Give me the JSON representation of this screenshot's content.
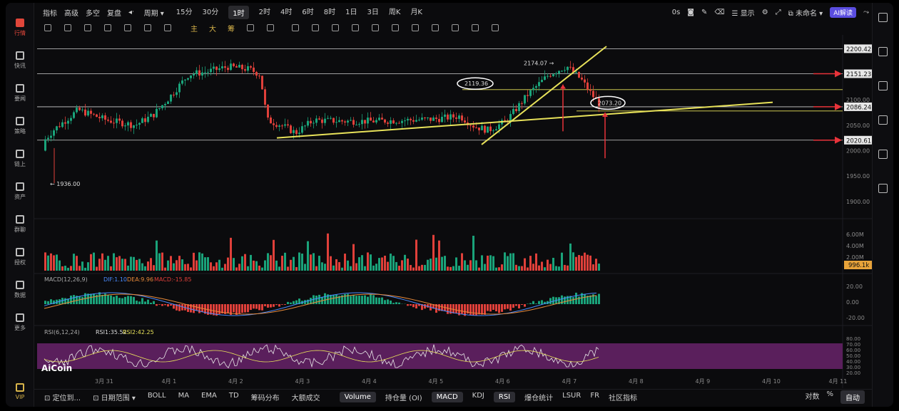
{
  "sidebar": {
    "items": [
      {
        "label": "行情",
        "icon": "chart-bar-icon",
        "active": true
      },
      {
        "label": "快讯",
        "icon": "news-icon"
      },
      {
        "label": "要闻",
        "icon": "article-icon"
      },
      {
        "label": "策略",
        "icon": "strategy-icon"
      },
      {
        "label": "链上",
        "icon": "chain-icon"
      },
      {
        "label": "资产",
        "icon": "wallet-icon"
      },
      {
        "label": "群聊",
        "icon": "chat-icon"
      },
      {
        "label": "授权",
        "icon": "key-icon"
      },
      {
        "label": "数据",
        "icon": "data-icon"
      },
      {
        "label": "更多",
        "icon": "grid-icon"
      },
      {
        "label": "VIP",
        "icon": "crown-icon"
      }
    ]
  },
  "toolbar": {
    "indicators": "指标",
    "advanced": "高级",
    "multi": "多空",
    "replay": "复盘",
    "period": "周期",
    "intervals": [
      "15分",
      "30分",
      "1时",
      "2时",
      "4时",
      "6时",
      "8时",
      "1日",
      "3日",
      "周K",
      "月K"
    ],
    "selected_interval": "1时",
    "zero_s": "0s",
    "display": "显示",
    "unnamed": "未命名",
    "ai": "AI解读"
  },
  "drawing_bar": {
    "main": "主",
    "large": "大",
    "chip": "筹"
  },
  "price_axis": {
    "ticks": [
      "2100.00",
      "2050.00",
      "2000.00",
      "1950.00",
      "1900.00"
    ],
    "labels": [
      {
        "text": "2200.42",
        "price": 2200.42,
        "style": "white"
      },
      {
        "text": "2151.23",
        "price": 2151.23,
        "style": "white"
      },
      {
        "text": "2086.24",
        "price": 2086.24,
        "style": "white"
      },
      {
        "text": "2020.61",
        "price": 2020.61,
        "style": "white"
      }
    ]
  },
  "annotations": {
    "high": "2174.07 →",
    "low": "← 1936.00",
    "circle1": "2119.36",
    "circle2": "2073.20"
  },
  "time_axis": [
    "3月 31",
    "4月 1",
    "4月 2",
    "4月 3",
    "4月 4",
    "4月 5",
    "4月 6",
    "4月 7",
    "4月 8",
    "4月 9",
    "4月 10",
    "4月 11"
  ],
  "volume": {
    "ticks": [
      "6.00M",
      "4.00M",
      "2.00M"
    ],
    "current": "996.1k"
  },
  "macd": {
    "title": "MACD(12,26,9)",
    "dif": "DIF:1.10",
    "dea": "DEA:9.96",
    "macd": "MACD:-15.85",
    "ticks": [
      "20.00",
      "0.00",
      "-20.00"
    ]
  },
  "rsi": {
    "title": "RSI(6,12,24)",
    "rsi1": "RSI1:35.52",
    "rsi2": "RSI2:42.25",
    "ticks": [
      "80.00",
      "70.00",
      "60.00",
      "50.00",
      "40.00",
      "30.00",
      "20.00"
    ]
  },
  "brand": "AiCoin",
  "bottom_bar": {
    "locate": "定位到...",
    "range": "日期范围",
    "indicators": [
      "BOLL",
      "MA",
      "EMA",
      "TD",
      "筹码分布",
      "大额成交"
    ],
    "panels": [
      "Volume",
      "持仓量 (OI)",
      "MACD",
      "KDJ",
      "RSI",
      "爆仓统计",
      "LSUR",
      "FR",
      "社区指标"
    ],
    "active_panels": [
      "Volume",
      "MACD",
      "RSI"
    ],
    "right": [
      "对数",
      "%",
      "自动"
    ]
  },
  "colors": {
    "up": "#1aa37a",
    "down": "#e0403a",
    "trend": "#e8e25a",
    "bg": "#0b0b0d",
    "rsi_band": "#5a1f5c",
    "accent": "#5a4de0"
  }
}
